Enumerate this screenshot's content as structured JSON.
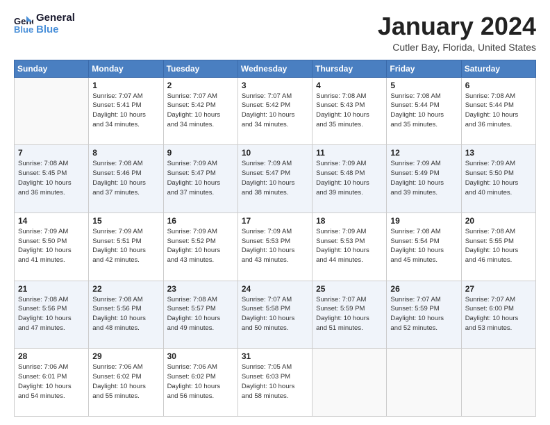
{
  "logo": {
    "line1": "General",
    "line2": "Blue"
  },
  "title": "January 2024",
  "subtitle": "Cutler Bay, Florida, United States",
  "weekdays": [
    "Sunday",
    "Monday",
    "Tuesday",
    "Wednesday",
    "Thursday",
    "Friday",
    "Saturday"
  ],
  "rows": [
    [
      {
        "day": "",
        "info": ""
      },
      {
        "day": "1",
        "info": "Sunrise: 7:07 AM\nSunset: 5:41 PM\nDaylight: 10 hours\nand 34 minutes."
      },
      {
        "day": "2",
        "info": "Sunrise: 7:07 AM\nSunset: 5:42 PM\nDaylight: 10 hours\nand 34 minutes."
      },
      {
        "day": "3",
        "info": "Sunrise: 7:07 AM\nSunset: 5:42 PM\nDaylight: 10 hours\nand 34 minutes."
      },
      {
        "day": "4",
        "info": "Sunrise: 7:08 AM\nSunset: 5:43 PM\nDaylight: 10 hours\nand 35 minutes."
      },
      {
        "day": "5",
        "info": "Sunrise: 7:08 AM\nSunset: 5:44 PM\nDaylight: 10 hours\nand 35 minutes."
      },
      {
        "day": "6",
        "info": "Sunrise: 7:08 AM\nSunset: 5:44 PM\nDaylight: 10 hours\nand 36 minutes."
      }
    ],
    [
      {
        "day": "7",
        "info": "Sunrise: 7:08 AM\nSunset: 5:45 PM\nDaylight: 10 hours\nand 36 minutes."
      },
      {
        "day": "8",
        "info": "Sunrise: 7:08 AM\nSunset: 5:46 PM\nDaylight: 10 hours\nand 37 minutes."
      },
      {
        "day": "9",
        "info": "Sunrise: 7:09 AM\nSunset: 5:47 PM\nDaylight: 10 hours\nand 37 minutes."
      },
      {
        "day": "10",
        "info": "Sunrise: 7:09 AM\nSunset: 5:47 PM\nDaylight: 10 hours\nand 38 minutes."
      },
      {
        "day": "11",
        "info": "Sunrise: 7:09 AM\nSunset: 5:48 PM\nDaylight: 10 hours\nand 39 minutes."
      },
      {
        "day": "12",
        "info": "Sunrise: 7:09 AM\nSunset: 5:49 PM\nDaylight: 10 hours\nand 39 minutes."
      },
      {
        "day": "13",
        "info": "Sunrise: 7:09 AM\nSunset: 5:50 PM\nDaylight: 10 hours\nand 40 minutes."
      }
    ],
    [
      {
        "day": "14",
        "info": "Sunrise: 7:09 AM\nSunset: 5:50 PM\nDaylight: 10 hours\nand 41 minutes."
      },
      {
        "day": "15",
        "info": "Sunrise: 7:09 AM\nSunset: 5:51 PM\nDaylight: 10 hours\nand 42 minutes."
      },
      {
        "day": "16",
        "info": "Sunrise: 7:09 AM\nSunset: 5:52 PM\nDaylight: 10 hours\nand 43 minutes."
      },
      {
        "day": "17",
        "info": "Sunrise: 7:09 AM\nSunset: 5:53 PM\nDaylight: 10 hours\nand 43 minutes."
      },
      {
        "day": "18",
        "info": "Sunrise: 7:09 AM\nSunset: 5:53 PM\nDaylight: 10 hours\nand 44 minutes."
      },
      {
        "day": "19",
        "info": "Sunrise: 7:08 AM\nSunset: 5:54 PM\nDaylight: 10 hours\nand 45 minutes."
      },
      {
        "day": "20",
        "info": "Sunrise: 7:08 AM\nSunset: 5:55 PM\nDaylight: 10 hours\nand 46 minutes."
      }
    ],
    [
      {
        "day": "21",
        "info": "Sunrise: 7:08 AM\nSunset: 5:56 PM\nDaylight: 10 hours\nand 47 minutes."
      },
      {
        "day": "22",
        "info": "Sunrise: 7:08 AM\nSunset: 5:56 PM\nDaylight: 10 hours\nand 48 minutes."
      },
      {
        "day": "23",
        "info": "Sunrise: 7:08 AM\nSunset: 5:57 PM\nDaylight: 10 hours\nand 49 minutes."
      },
      {
        "day": "24",
        "info": "Sunrise: 7:07 AM\nSunset: 5:58 PM\nDaylight: 10 hours\nand 50 minutes."
      },
      {
        "day": "25",
        "info": "Sunrise: 7:07 AM\nSunset: 5:59 PM\nDaylight: 10 hours\nand 51 minutes."
      },
      {
        "day": "26",
        "info": "Sunrise: 7:07 AM\nSunset: 5:59 PM\nDaylight: 10 hours\nand 52 minutes."
      },
      {
        "day": "27",
        "info": "Sunrise: 7:07 AM\nSunset: 6:00 PM\nDaylight: 10 hours\nand 53 minutes."
      }
    ],
    [
      {
        "day": "28",
        "info": "Sunrise: 7:06 AM\nSunset: 6:01 PM\nDaylight: 10 hours\nand 54 minutes."
      },
      {
        "day": "29",
        "info": "Sunrise: 7:06 AM\nSunset: 6:02 PM\nDaylight: 10 hours\nand 55 minutes."
      },
      {
        "day": "30",
        "info": "Sunrise: 7:06 AM\nSunset: 6:02 PM\nDaylight: 10 hours\nand 56 minutes."
      },
      {
        "day": "31",
        "info": "Sunrise: 7:05 AM\nSunset: 6:03 PM\nDaylight: 10 hours\nand 58 minutes."
      },
      {
        "day": "",
        "info": ""
      },
      {
        "day": "",
        "info": ""
      },
      {
        "day": "",
        "info": ""
      }
    ]
  ]
}
